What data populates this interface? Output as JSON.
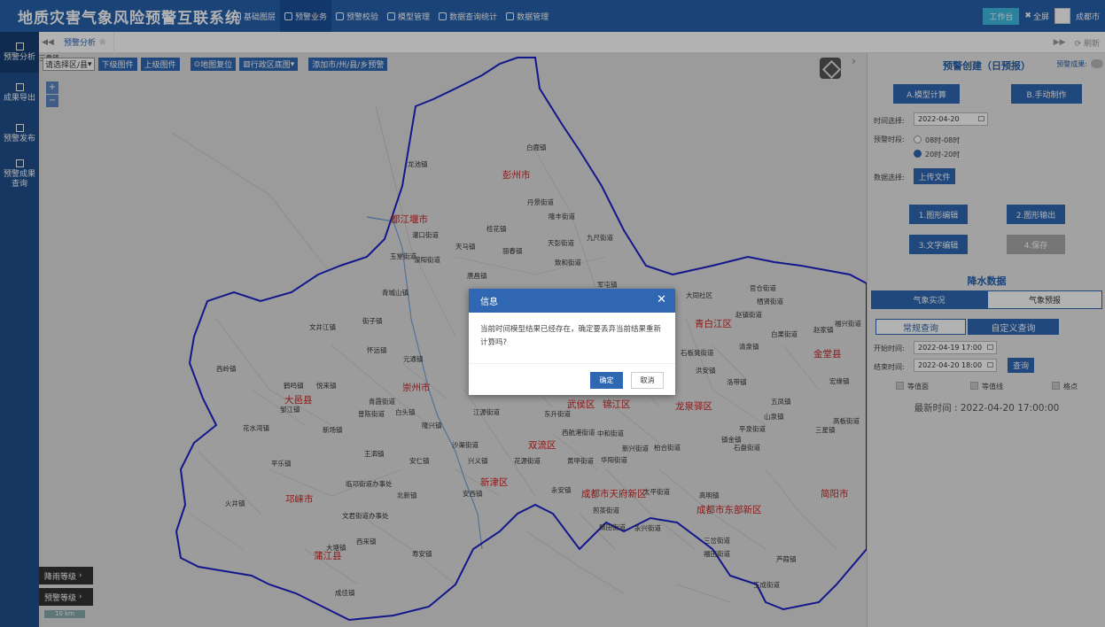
{
  "app_title": "地质灾害气象风险预警互联系统",
  "nav": [
    {
      "label": "基础图层",
      "icon": "layers-icon",
      "active": false
    },
    {
      "label": "预警业务",
      "icon": "chart-icon",
      "active": true
    },
    {
      "label": "预警校验",
      "icon": "document-icon",
      "active": false
    },
    {
      "label": "模型管理",
      "icon": "cube-icon",
      "active": false
    },
    {
      "label": "数据查询统计",
      "icon": "chat-icon",
      "active": false
    },
    {
      "label": "数据管理",
      "icon": "database-icon",
      "active": false
    }
  ],
  "header_right": {
    "workbench": "工作台",
    "fullscreen": "全屏",
    "city": "成都市"
  },
  "sidebar": [
    {
      "label": "预警分析",
      "active": true
    },
    {
      "label": "成果导出",
      "active": false
    },
    {
      "label": "预警发布",
      "active": false
    },
    {
      "label": "预警成果查询",
      "active": false
    }
  ],
  "tabbar": {
    "tab": "预警分析",
    "refresh": "刷新"
  },
  "map_toolbar": {
    "area_select": "请选择区/县",
    "lower_level": "下级图件",
    "upper_level": "上级图件",
    "reset_map": "地图复位",
    "admin_basemap": "行政区底图",
    "add_city_warning": "添加市/州/县/乡预警"
  },
  "legend": {
    "rain_level": "降雨等级",
    "warning_level": "预警等级",
    "scale": "10 km"
  },
  "map_labels": [
    {
      "text": "彭州市",
      "red": true
    },
    {
      "text": "都江堰市",
      "red": true
    },
    {
      "text": "崇州市",
      "red": true
    },
    {
      "text": "大邑县",
      "red": true
    },
    {
      "text": "邛崃市",
      "red": true
    },
    {
      "text": "蒲江县",
      "red": true
    },
    {
      "text": "新津区",
      "red": true
    },
    {
      "text": "双流区",
      "red": true
    },
    {
      "text": "武侯区",
      "red": true
    },
    {
      "text": "锦江区",
      "red": true
    },
    {
      "text": "龙泉驿区",
      "red": true
    },
    {
      "text": "青白江区",
      "red": true
    },
    {
      "text": "金堂县",
      "red": true
    },
    {
      "text": "成都市天府新区",
      "red": true
    },
    {
      "text": "成都市东部新区",
      "red": true
    },
    {
      "text": "简阳市",
      "red": true
    },
    {
      "text": "龙池镇",
      "red": false
    },
    {
      "text": "白鹿镇",
      "red": false
    },
    {
      "text": "丹景街道",
      "red": false
    },
    {
      "text": "隆丰街道",
      "red": false
    },
    {
      "text": "桂花镇",
      "red": false
    },
    {
      "text": "天彭街道",
      "red": false
    },
    {
      "text": "九尺街道",
      "red": false
    },
    {
      "text": "丽春镇",
      "red": false
    },
    {
      "text": "致和街道",
      "red": false
    },
    {
      "text": "濛阳街道",
      "red": false
    },
    {
      "text": "灌口街道",
      "red": false
    },
    {
      "text": "天马镇",
      "red": false
    },
    {
      "text": "玉堂街道",
      "red": false
    },
    {
      "text": "唐昌镇",
      "red": false
    },
    {
      "text": "青城山镇",
      "red": false
    },
    {
      "text": "军屯镇",
      "red": false
    },
    {
      "text": "街子镇",
      "red": false
    },
    {
      "text": "文井江镇",
      "red": false
    },
    {
      "text": "怀远镇",
      "red": false
    },
    {
      "text": "元通镇",
      "red": false
    },
    {
      "text": "西岭镇",
      "red": false
    },
    {
      "text": "鹤鸣镇",
      "red": false
    },
    {
      "text": "悦来镇",
      "red": false
    },
    {
      "text": "青霞街道",
      "red": false
    },
    {
      "text": "邹江镇",
      "red": false
    },
    {
      "text": "普陈街道",
      "red": false
    },
    {
      "text": "白头镇",
      "red": false
    },
    {
      "text": "新场镇",
      "red": false
    },
    {
      "text": "花水湾镇",
      "red": false
    },
    {
      "text": "隆兴镇",
      "red": false
    },
    {
      "text": "王泗镇",
      "red": false
    },
    {
      "text": "沙渠街道",
      "red": false
    },
    {
      "text": "安仁镇",
      "red": false
    },
    {
      "text": "平乐镇",
      "red": false
    },
    {
      "text": "临邛街道办事处",
      "red": false
    },
    {
      "text": "兴义镇",
      "red": false
    },
    {
      "text": "花源街道",
      "red": false
    },
    {
      "text": "黄甲街道",
      "red": false
    },
    {
      "text": "华阳街道",
      "red": false
    },
    {
      "text": "安西镇",
      "red": false
    },
    {
      "text": "永安镇",
      "red": false
    },
    {
      "text": "火井镇",
      "red": false
    },
    {
      "text": "文君街道办事处",
      "red": false
    },
    {
      "text": "大塘镇",
      "red": false
    },
    {
      "text": "西来镇",
      "red": false
    },
    {
      "text": "寿安镇",
      "red": false
    },
    {
      "text": "成佳镇",
      "red": false
    },
    {
      "text": "北新镇",
      "red": false
    },
    {
      "text": "煎茶街道",
      "red": false
    },
    {
      "text": "籍田街道",
      "red": false
    },
    {
      "text": "永兴街道",
      "red": false
    },
    {
      "text": "太平街道",
      "red": false
    },
    {
      "text": "东升街道",
      "red": false
    },
    {
      "text": "江源街道",
      "red": false
    },
    {
      "text": "西航港街道",
      "red": false
    },
    {
      "text": "中和街道",
      "red": false
    },
    {
      "text": "新兴街道",
      "red": false
    },
    {
      "text": "柏合街道",
      "red": false
    },
    {
      "text": "高明镇",
      "red": false
    },
    {
      "text": "三岔街道",
      "red": false
    },
    {
      "text": "福田街道",
      "red": false
    },
    {
      "text": "芦葭镇",
      "red": false
    },
    {
      "text": "石板凳街道",
      "red": false
    },
    {
      "text": "洪安镇",
      "red": false
    },
    {
      "text": "洛带镇",
      "red": false
    },
    {
      "text": "清泉镇",
      "red": false
    },
    {
      "text": "五凤镇",
      "red": false
    },
    {
      "text": "白果街道",
      "red": false
    },
    {
      "text": "赵家镇",
      "red": false
    },
    {
      "text": "福兴街道",
      "red": false
    },
    {
      "text": "三星镇",
      "red": false
    },
    {
      "text": "官仓街道",
      "red": false
    },
    {
      "text": "大同社区",
      "red": false
    },
    {
      "text": "赵镇街道",
      "red": false
    },
    {
      "text": "栖贤街道",
      "red": false
    },
    {
      "text": "石盘街道",
      "red": false
    },
    {
      "text": "平泉街道",
      "red": false
    },
    {
      "text": "玉成街道",
      "red": false
    },
    {
      "text": "镇金镇",
      "red": false
    },
    {
      "text": "山泉镇",
      "red": false
    },
    {
      "text": "宏缘镇",
      "red": false
    },
    {
      "text": "高板街道",
      "red": false
    },
    {
      "text": "三皇镇",
      "red": false
    }
  ],
  "panel": {
    "title": "预警创建（日预报）",
    "result_label": "预警成果:",
    "model_calc": "A.模型计算",
    "manual_make": "B.手动制作",
    "time_label": "时间选择:",
    "time_value": "2022-04-20",
    "period_label": "预警时段:",
    "period_opt1": "08时-08时",
    "period_opt2": "20时-20时",
    "data_label": "数据选择:",
    "upload": "上传文件",
    "edit_graph": "1.图形编辑",
    "export_graph": "2.图形输出",
    "edit_text": "3.文字编辑",
    "save": "4.保存",
    "rain_title": "降水数据",
    "tab_actual": "气象实况",
    "tab_forecast": "气象预报",
    "query_normal": "常规查询",
    "query_custom": "自定义查询",
    "start_label": "开始时间:",
    "start_value": "2022-04-19 17:00",
    "end_label": "结束时间:",
    "end_value": "2022-04-20 18:00",
    "query_btn": "查询",
    "chk_area": "等值面",
    "chk_line": "等值线",
    "chk_grid": "格点",
    "latest": "最新时间 : 2022-04-20 17:00:00"
  },
  "dialog": {
    "title": "信息",
    "message": "当前时间模型结果已经存在，确定要丢弃当前结果重新计算吗?",
    "ok": "确定",
    "cancel": "取消"
  },
  "colors": {
    "header": "#2660ad",
    "sidebar": "#1f4f8d",
    "accent": "#2f67b2",
    "boundary": "#1c22c7",
    "label_red": "#c22"
  }
}
